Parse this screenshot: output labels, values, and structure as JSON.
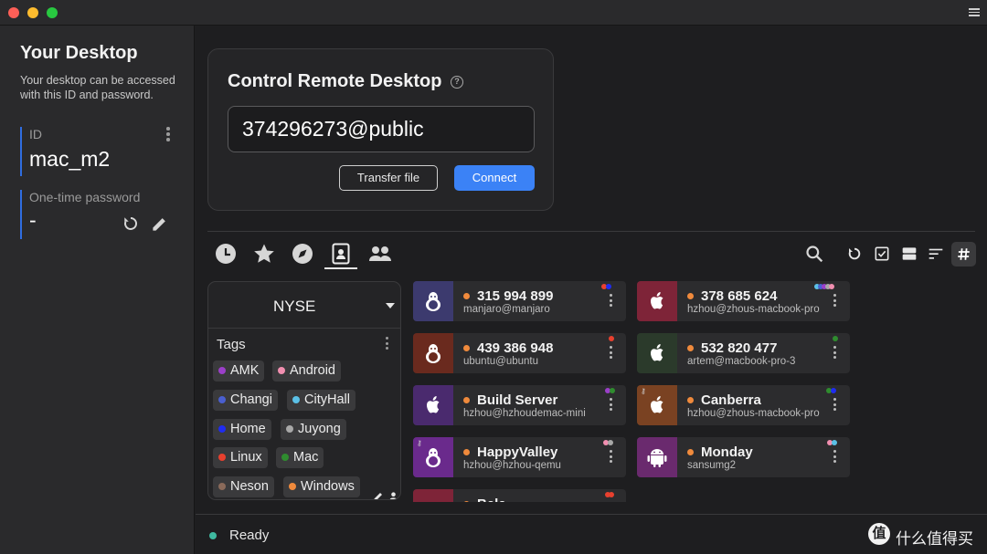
{
  "colors": {
    "accent": "#3b82f6",
    "id_border": "#2f6de1",
    "online": "#f08a3c",
    "ready": "#3fb9a0"
  },
  "window": {
    "controls": [
      {
        "name": "close",
        "color": "#fe5f57"
      },
      {
        "name": "minimize",
        "color": "#febc2e"
      },
      {
        "name": "zoom",
        "color": "#28c840"
      }
    ],
    "menu_icon": "hamburger-menu-icon"
  },
  "sidebar": {
    "title": "Your Desktop",
    "description": "Your desktop can be accessed with this ID and password.",
    "id_label": "ID",
    "id_value": "mac_m2",
    "password_label": "One-time password",
    "password_value": "-",
    "icons": [
      "more-options-icon",
      "refresh-icon",
      "edit-pencil-icon"
    ]
  },
  "connect": {
    "title": "Control Remote Desktop",
    "help_icon": "help-circle-icon",
    "id_input_value": "374296273@public",
    "transfer_label": "Transfer file",
    "connect_label": "Connect"
  },
  "tabs": [
    {
      "icon": "history-clock-icon",
      "active": false
    },
    {
      "icon": "favorites-star-icon",
      "active": false
    },
    {
      "icon": "discovered-compass-icon",
      "active": false
    },
    {
      "icon": "address-book-icon",
      "active": true
    },
    {
      "icon": "group-people-icon",
      "active": false
    }
  ],
  "toolbar": {
    "icons": [
      "search-icon",
      "refresh-icon",
      "select-checkbox-icon",
      "list-view-icon",
      "sort-icon",
      "hash-icon"
    ],
    "active": "hash-icon"
  },
  "tags_panel": {
    "selector_label": "NYSE",
    "tags_title": "Tags",
    "tags": [
      {
        "label": "AMK",
        "color": "#9b3fc9"
      },
      {
        "label": "Android",
        "color": "#f18fb0"
      },
      {
        "label": "Changi",
        "color": "#4a5fd0"
      },
      {
        "label": "CityHall",
        "color": "#5bc0e6"
      },
      {
        "label": "Home",
        "color": "#1f2cf0"
      },
      {
        "label": "Juyong",
        "color": "#a8a8a8"
      },
      {
        "label": "Linux",
        "color": "#e8402e"
      },
      {
        "label": "Mac",
        "color": "#2f8c2f"
      },
      {
        "label": "Neson",
        "color": "#8a6a5a"
      },
      {
        "label": "Windows",
        "color": "#f08a3c"
      }
    ],
    "footer_icons": [
      "edit-pencil-icon",
      "person-icon"
    ]
  },
  "peers": [
    {
      "id": "315 994 899",
      "user": "manjaro@manjaro",
      "os": "linux",
      "avatar_color": "#3c3a6e",
      "tag_colors": [
        "#e8402e",
        "#1f2cf0"
      ]
    },
    {
      "id": "378 685 624",
      "user": "hzhou@zhous-macbook-pro",
      "os": "mac",
      "avatar_color": "#7e2438",
      "tag_colors": [
        "#5bc0e6",
        "#4a5fd0",
        "#9b3fc9",
        "#a8a8a8",
        "#f18fb0"
      ]
    },
    {
      "id": "439 386 948",
      "user": "ubuntu@ubuntu",
      "os": "linux",
      "avatar_color": "#6a2a1e",
      "tag_colors": [
        "#e8402e"
      ]
    },
    {
      "id": "532 820 477",
      "user": "artem@macbook-pro-3",
      "os": "mac",
      "avatar_color": "#2b3a2b",
      "tag_colors": [
        "#2f8c2f"
      ]
    },
    {
      "id": "Build Server",
      "user": "hzhou@hzhoudemac-mini",
      "os": "mac",
      "avatar_color": "#4a2a6e",
      "tag_colors": [
        "#9b3fc9",
        "#2f8c2f"
      ]
    },
    {
      "id": "Canberra",
      "user": "hzhou@zhous-macbook-pro",
      "os": "mac",
      "avatar_color": "#7a4222",
      "tag_colors": [
        "#2f8c2f",
        "#1f2cf0"
      ]
    },
    {
      "id": "HappyValley",
      "user": "hzhou@hzhou-qemu",
      "os": "linux",
      "avatar_color": "#6a2a8c",
      "tag_colors": [
        "#f18fb0",
        "#a8a8a8"
      ]
    },
    {
      "id": "Monday",
      "user": "sansumg2",
      "os": "android",
      "avatar_color": "#6a2a6e",
      "tag_colors": [
        "#f18fb0",
        "#5bc0e6"
      ]
    },
    {
      "id": "Bala",
      "user": "",
      "os": "linux",
      "avatar_color": "#7e2438",
      "tag_colors": [
        "#e8402e"
      ]
    }
  ],
  "status": {
    "text": "Ready"
  },
  "watermark": {
    "symbol": "值",
    "text": "什么值得买"
  }
}
